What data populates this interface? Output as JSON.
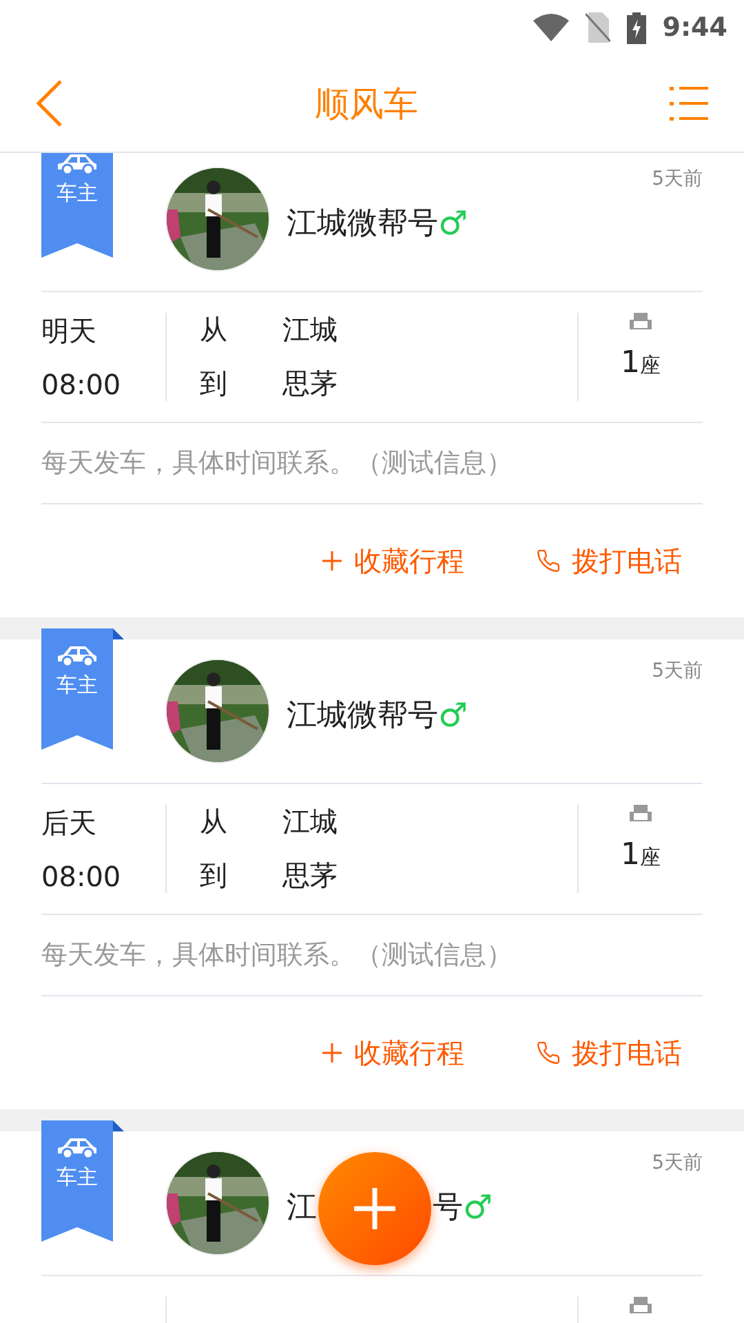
{
  "status_bar": {
    "time": "9:44"
  },
  "header": {
    "title": "顺风车"
  },
  "posts": [
    {
      "role": "车主",
      "avatar": {
        "kind": "picture"
      },
      "name": "江城微帮号",
      "gender_symbol": "♂",
      "time": "5天前",
      "day": "明天",
      "clock": "08:00",
      "from_label": "从",
      "from": "江城",
      "to_label": "到",
      "to": "思茅",
      "seats": "1",
      "seat_unit": "座",
      "note": "每天发车，具体时间联系。（测试信息）",
      "actions": [
        {
          "kind": "favorite",
          "label": "收藏行程"
        },
        {
          "kind": "call",
          "label": "拨打电话"
        }
      ]
    },
    {
      "role": "车主",
      "avatar": {
        "kind": "picture"
      },
      "name": "江城微帮号",
      "gender_symbol": "♂",
      "time": "5天前",
      "day": "后天",
      "clock": "08:00",
      "from_label": "从",
      "from": "江城",
      "to_label": "到",
      "to": "思茅",
      "seats": "1",
      "seat_unit": "座",
      "note": "每天发车，具体时间联系。（测试信息）",
      "actions": [
        {
          "kind": "favorite",
          "label": "收藏行程"
        },
        {
          "kind": "call",
          "label": "拨打电话"
        }
      ]
    },
    {
      "role": "车主",
      "avatar": {
        "kind": "picture"
      },
      "name_parts": [
        "江",
        "号"
      ],
      "gender_symbol": "♂",
      "time": "5天前"
    }
  ]
}
